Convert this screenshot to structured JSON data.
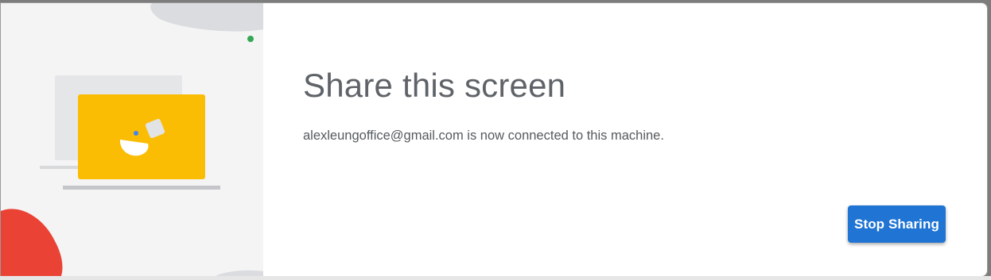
{
  "dialog": {
    "title": "Share this screen",
    "message": "alexleungoffice@gmail.com is now connected to this machine.",
    "stop_button_label": "Stop Sharing"
  },
  "colors": {
    "accent_button": "#1f74d4",
    "laptop_screen": "#fbbc04",
    "blob_red": "#ea4335",
    "status_dot": "#34a853",
    "illustration_background": "#f4f4f5"
  },
  "icons": {
    "illustration": "screen-share-laptop-illustration",
    "status": "connected-status-dot"
  }
}
